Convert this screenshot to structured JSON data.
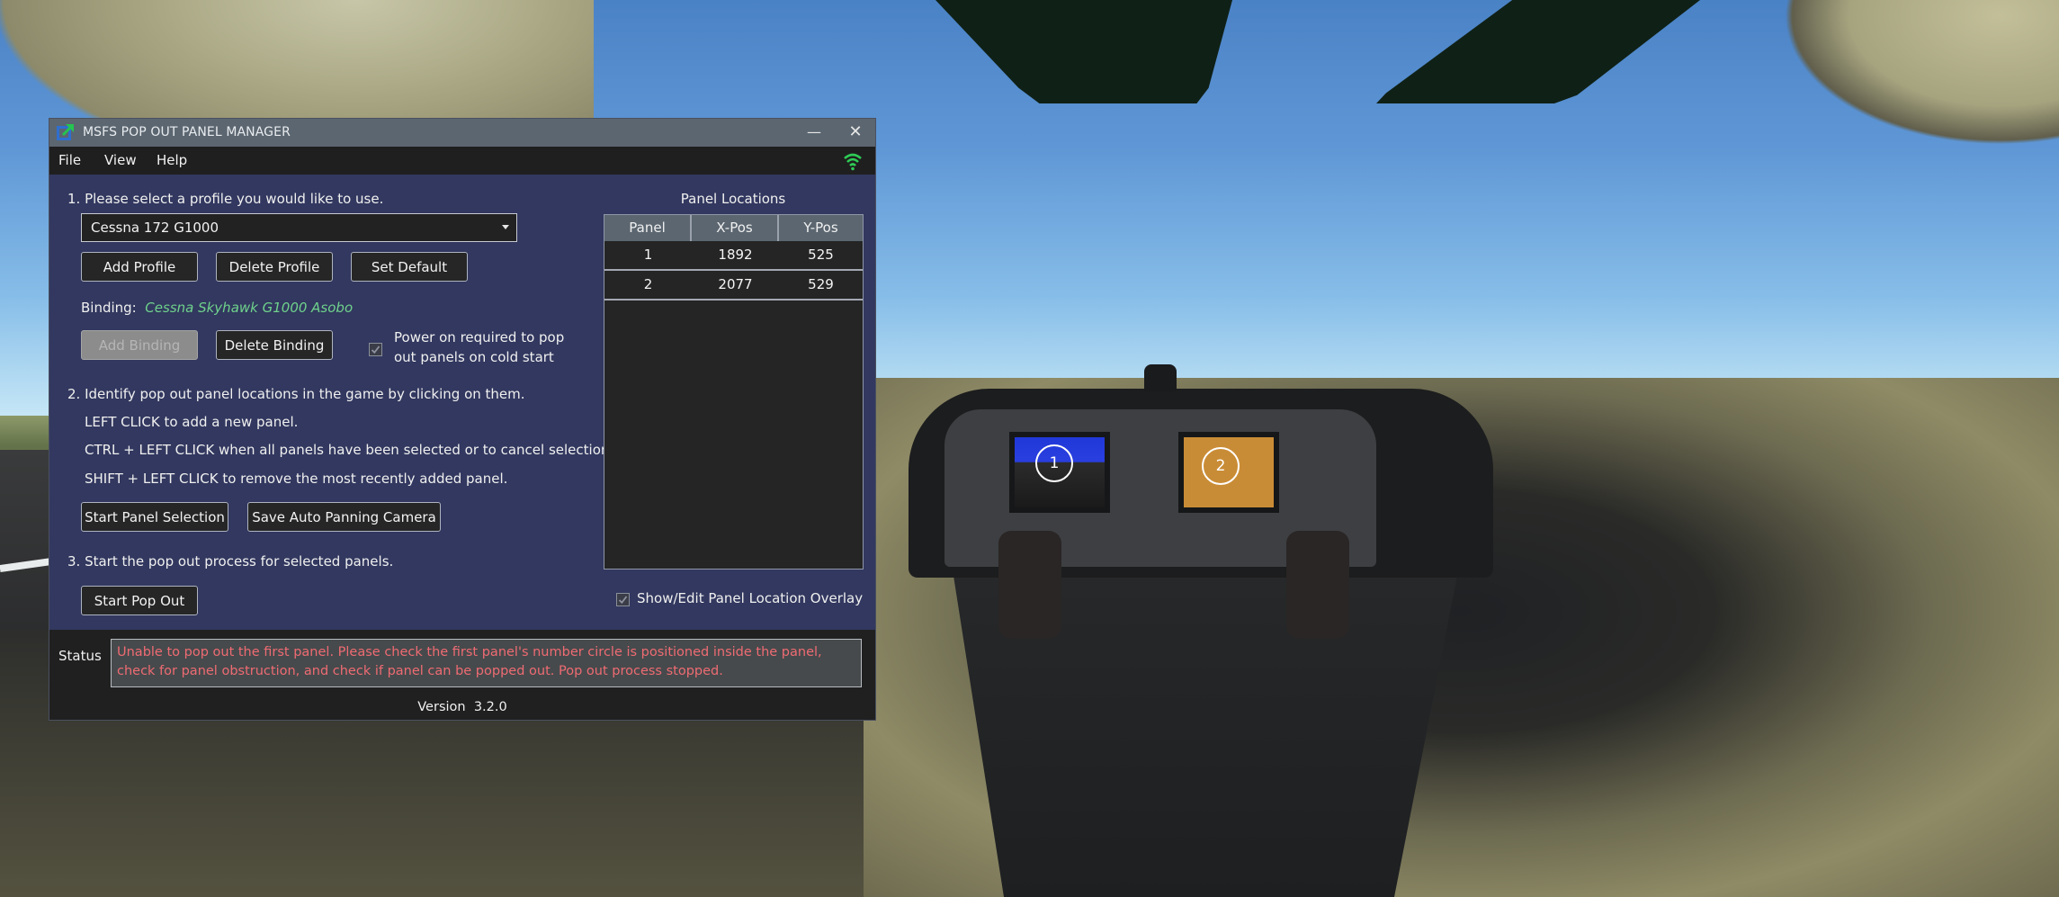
{
  "window": {
    "title": "MSFS POP OUT PANEL MANAGER",
    "minimize_label": "—",
    "close_label": "✕"
  },
  "menu": {
    "items": [
      "File",
      "View",
      "Help"
    ],
    "connection_icon": "wifi-icon",
    "connection_color": "#2ecc55"
  },
  "step1": {
    "heading": "1. Please select a profile you would like to use.",
    "profile_select": {
      "value": "Cessna 172 G1000"
    },
    "buttons": {
      "add_profile": "Add Profile",
      "delete_profile": "Delete Profile",
      "set_default": "Set Default"
    },
    "binding_label": "Binding:",
    "binding_value": "Cessna Skyhawk G1000 Asobo",
    "add_binding": "Add Binding",
    "delete_binding": "Delete Binding",
    "power_on_checkbox": {
      "checked": true,
      "label_line1": "Power on required to pop",
      "label_line2": "out panels on cold start"
    }
  },
  "step2": {
    "heading": "2. Identify pop out panel locations in the game by clicking on them.",
    "instructions": [
      "LEFT CLICK to add a new panel.",
      "CTRL + LEFT CLICK when all panels have been selected or to cancel selections.",
      "SHIFT + LEFT CLICK to remove the most recently added panel."
    ],
    "start_panel_selection": "Start Panel Selection",
    "save_auto_panning_camera": "Save Auto Panning Camera"
  },
  "step3": {
    "heading": "3. Start the pop out process for selected panels.",
    "start_pop_out": "Start Pop Out"
  },
  "panel_locations": {
    "title": "Panel Locations",
    "columns": [
      "Panel",
      "X-Pos",
      "Y-Pos"
    ],
    "rows": [
      {
        "panel": "1",
        "x": "1892",
        "y": "525"
      },
      {
        "panel": "2",
        "x": "2077",
        "y": "529"
      }
    ],
    "overlay_checkbox": {
      "checked": true,
      "label": "Show/Edit Panel Location Overlay"
    }
  },
  "status": {
    "label": "Status",
    "message": "Unable to pop out the first panel. Please check the first panel's number circle is positioned inside the panel, check for panel obstruction, and check if panel can be popped out. Pop out process stopped.",
    "message_color": "#ef6b73"
  },
  "version": {
    "label": "Version",
    "value": "3.2.0"
  },
  "game_overlay": {
    "circles": [
      "1",
      "2"
    ]
  }
}
